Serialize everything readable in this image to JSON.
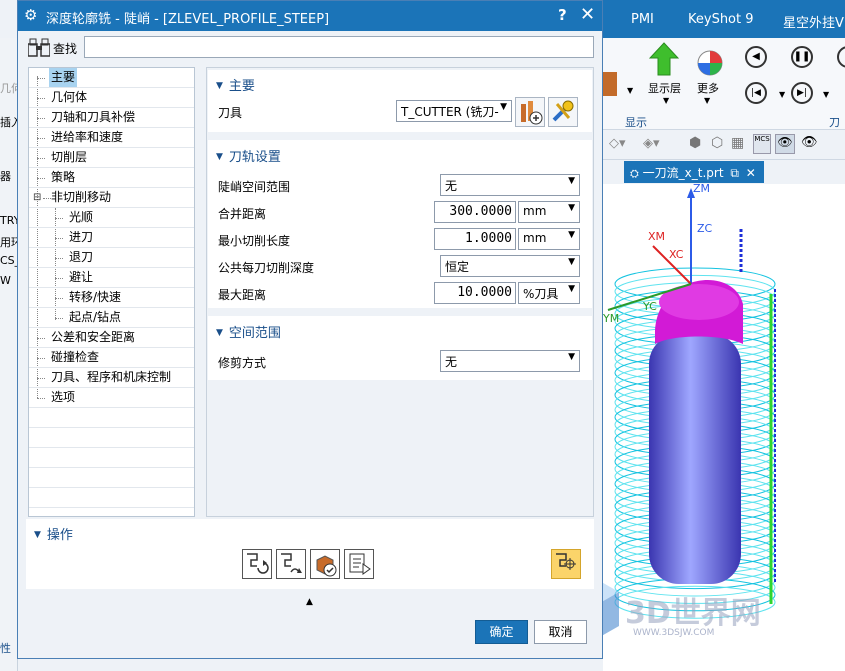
{
  "dialog": {
    "title": "深度轮廓铣 - 陡峭 - [ZLEVEL_PROFILE_STEEP]",
    "help": "?",
    "close": "✕",
    "search_label": "查找",
    "search_value": ""
  },
  "tree": [
    {
      "label": "主要"
    },
    {
      "label": "几何体"
    },
    {
      "label": "刀轴和刀具补偿"
    },
    {
      "label": "进给率和速度"
    },
    {
      "label": "切削层"
    },
    {
      "label": "策略"
    },
    {
      "label": "非切削移动"
    },
    {
      "label": "光顺"
    },
    {
      "label": "进刀"
    },
    {
      "label": "退刀"
    },
    {
      "label": "避让"
    },
    {
      "label": "转移/快速"
    },
    {
      "label": "起点/钻点"
    },
    {
      "label": "公差和安全距离"
    },
    {
      "label": "碰撞检查"
    },
    {
      "label": "刀具、程序和机床控制"
    },
    {
      "label": "选项"
    }
  ],
  "main_section": {
    "title": "主要",
    "tool_label": "刀具",
    "tool_value": "T_CUTTER (铣刀-"
  },
  "path_section": {
    "title": "刀轨设置",
    "steep_label": "陡峭空间范围",
    "steep_value": "无",
    "merge_label": "合并距离",
    "merge_value": "300.0000",
    "merge_unit": "mm",
    "minlen_label": "最小切削长度",
    "minlen_value": "1.0000",
    "minlen_unit": "mm",
    "depth_label": "公共每刀切削深度",
    "depth_value": "恒定",
    "maxdist_label": "最大距离",
    "maxdist_value": "10.0000",
    "maxdist_unit": "%刀具"
  },
  "space_section": {
    "title": "空间范围",
    "trim_label": "修剪方式",
    "trim_value": "无"
  },
  "ops": {
    "title": "操作"
  },
  "buttons": {
    "ok": "确定",
    "cancel": "取消"
  },
  "app": {
    "tabs": [
      "PMI",
      "KeyShot 9",
      "星空外挂V"
    ],
    "ribbon_display_layer": "显示层",
    "ribbon_more": "更多",
    "ribbon_group_display": "显示",
    "ribbon_group_right": "刀",
    "doc_tab": "一刀流_x_t.prt",
    "axes": {
      "zm": "ZM",
      "zc": "ZC",
      "xm": "XM",
      "xc": "XC",
      "yc": "YC",
      "ym": "YM"
    },
    "left_strip": [
      "几何",
      "插入",
      "器",
      "TRY",
      "用环",
      "CS_",
      "W",
      "性"
    ]
  },
  "watermark": {
    "text": "3D世界网",
    "url": "WWW.3DSJW.COM"
  },
  "colors": {
    "title_bar": "#1b74b8",
    "section_head": "#1a4f8a",
    "selection": "#a8d3f0",
    "toolpath": "#19d6e0",
    "part": "#d21ad6"
  }
}
